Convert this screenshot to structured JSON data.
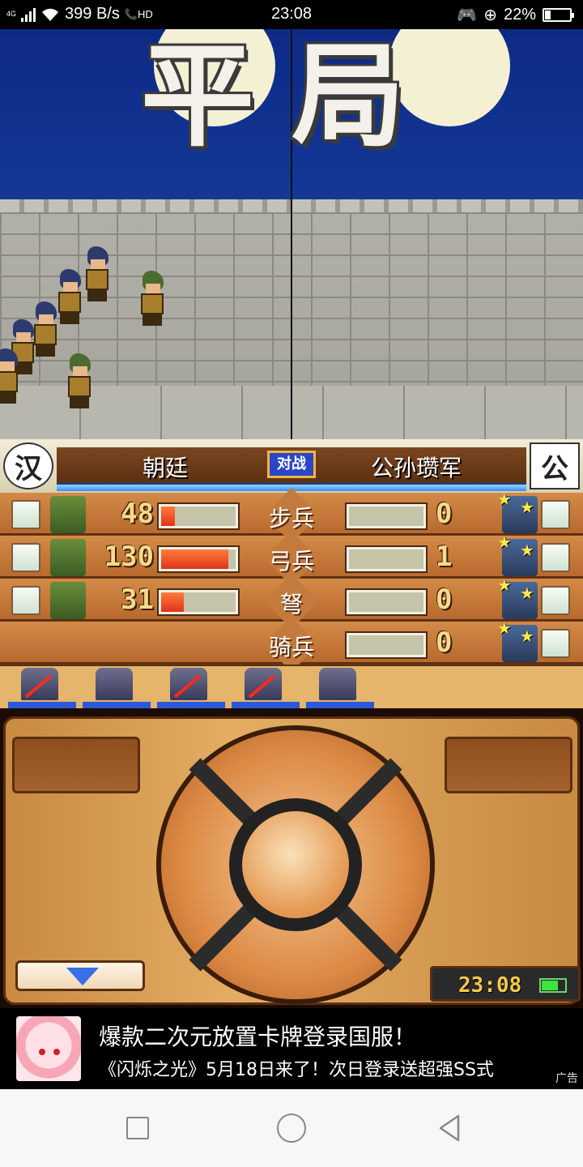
{
  "status_bar": {
    "network_tag": "4G",
    "speed": "399 B/s",
    "hd_tag": "HD",
    "time": "23:08",
    "battery": "22%",
    "battery_level": 0.22
  },
  "scene": {
    "result_text": "平局"
  },
  "battle": {
    "left_emblem": "汉",
    "right_emblem": "公",
    "left_team": "朝廷",
    "vs_label": "对战",
    "right_team": "公孙瓒军",
    "rows": [
      {
        "unit": "步兵",
        "left_count": "48",
        "left_fill": 0.18,
        "right_count": "0",
        "right_fill": 0.0,
        "left_present": true
      },
      {
        "unit": "弓兵",
        "left_count": "130",
        "left_fill": 0.9,
        "right_count": "1",
        "right_fill": 0.0,
        "left_present": true
      },
      {
        "unit": "弩",
        "left_count": "31",
        "left_fill": 0.3,
        "right_count": "0",
        "right_fill": 0.0,
        "left_present": true
      },
      {
        "unit": "骑兵",
        "left_count": "",
        "left_fill": 0.0,
        "right_count": "0",
        "right_fill": 0.0,
        "left_present": false
      }
    ],
    "generals": [
      "general-1",
      "general-2",
      "general-3",
      "general-4",
      "general-5"
    ]
  },
  "controller": {
    "clock": "23:08",
    "battery_level": 0.7,
    "down_icon": "triangle-down-icon"
  },
  "ad": {
    "title": "爆款二次元放置卡牌登录国服！",
    "description": "《闪烁之光》5月18日来了！次日登录送超强SS式",
    "label": "广告"
  },
  "nav": {
    "recent_icon": "square-icon",
    "home_icon": "circle-icon",
    "back_icon": "back-triangle-icon"
  }
}
